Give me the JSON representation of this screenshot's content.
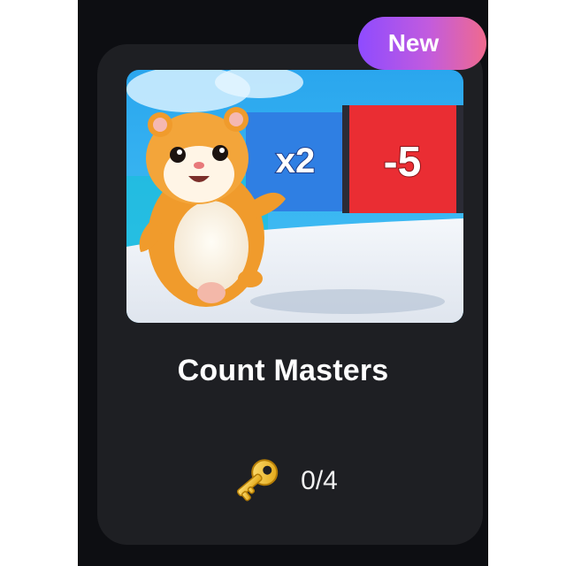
{
  "badge": {
    "label": "New"
  },
  "game": {
    "title": "Count Masters",
    "thumbnail": {
      "gate_left_text": "x2",
      "gate_right_text": "-5"
    }
  },
  "keys": {
    "icon": "key-icon",
    "count": "0/4"
  },
  "colors": {
    "card_background": "#1e1f23",
    "page_background": "#0d0e12",
    "badge_gradient": [
      "#8e4bff",
      "#f06a8e"
    ],
    "text": "#ffffff"
  }
}
